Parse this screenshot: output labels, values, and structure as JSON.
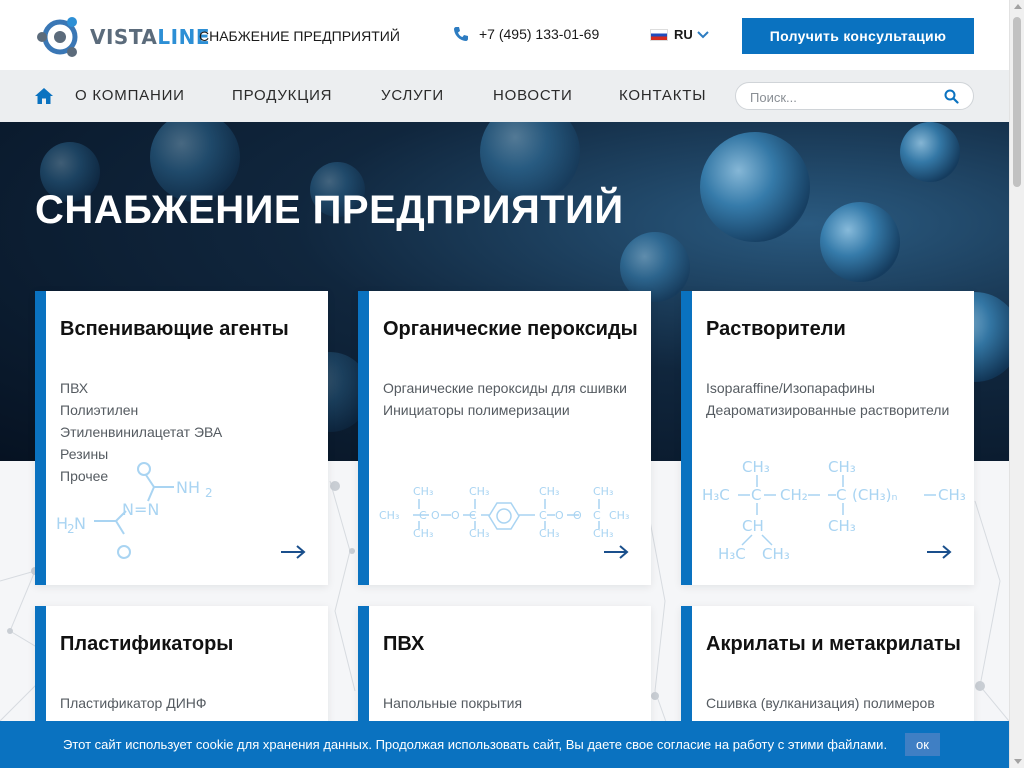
{
  "header": {
    "logo_text_a": "VISTA",
    "logo_text_b": "LINE",
    "tagline": "СНАБЖЕНИЕ ПРЕДПРИЯТИЙ",
    "phone": "+7 (495) 133-01-69",
    "language": "RU",
    "consult_button": "Получить консультацию"
  },
  "nav": {
    "items": [
      "О КОМПАНИИ",
      "ПРОДУКЦИЯ",
      "УСЛУГИ",
      "НОВОСТИ",
      "КОНТАКТЫ"
    ],
    "search_placeholder": "Поиск..."
  },
  "hero": {
    "title": "СНАБЖЕНИЕ ПРЕДПРИЯТИЙ"
  },
  "cards": [
    {
      "title": "Вспенивающие агенты",
      "links": [
        "ПВХ",
        "Полиэтилен",
        "Этиленвинилацетат ЭВА",
        "Резины",
        "Прочее"
      ]
    },
    {
      "title": "Органические пероксиды",
      "links": [
        "Органические пероксиды для сшивки",
        "Инициаторы полимеризации"
      ]
    },
    {
      "title": "Растворители",
      "links": [
        "Isoparaffine/Изопарафины",
        "Деароматизированные растворители"
      ]
    },
    {
      "title": "Пластификаторы",
      "links": [
        "Пластификатор ДИНФ"
      ]
    },
    {
      "title": "ПВХ",
      "links": [
        "Напольные покрытия"
      ]
    },
    {
      "title": "Акрилаты и метакрилаты",
      "links": [
        "Сшивка (вулканизация) полимеров"
      ]
    }
  ],
  "cookie": {
    "text": "Этот сайт использует cookie для хранения данных. Продолжая использовать сайт, Вы даете свое согласие на работу с этими файлами.",
    "ok_label": "ок"
  },
  "colors": {
    "accent": "#0a72c0",
    "header_bg": "#ffffff",
    "nav_bg": "#eceef0",
    "hero_bg": "#10263d",
    "molecule": "#a9d4f2"
  }
}
